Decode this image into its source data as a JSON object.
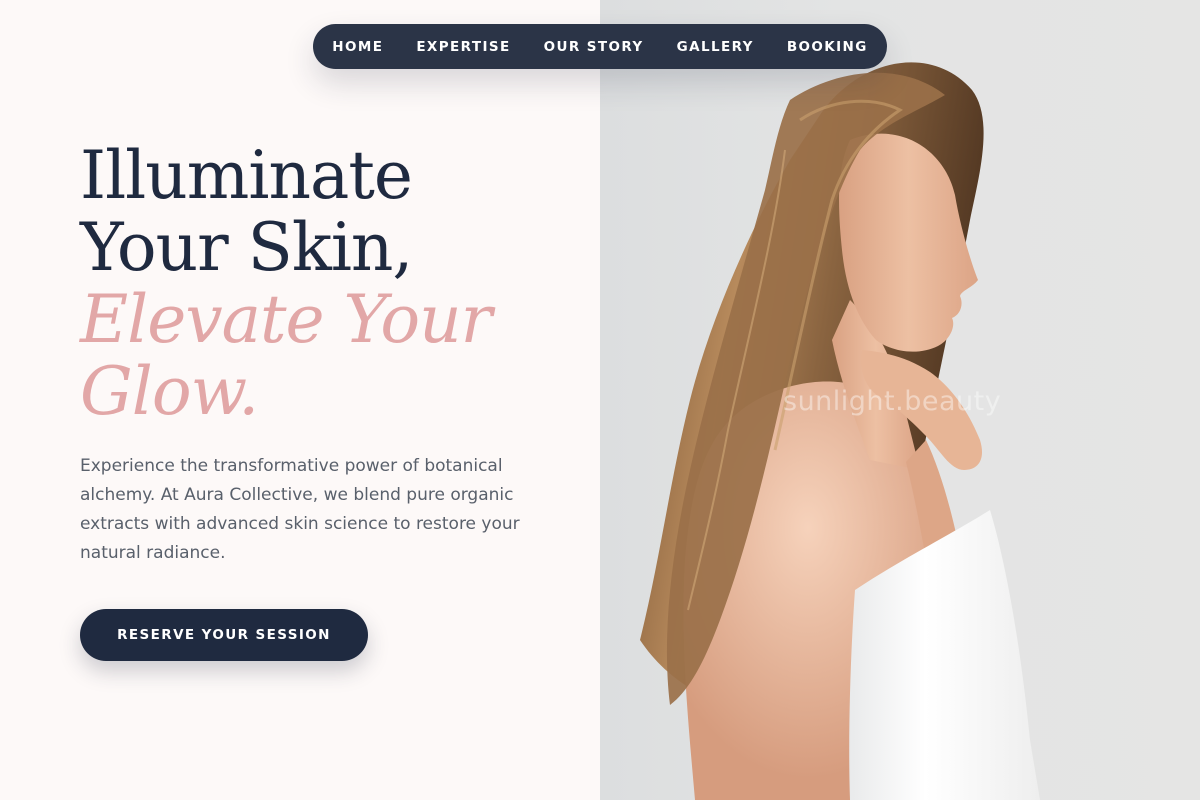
{
  "nav": {
    "items": [
      {
        "label": "HOME"
      },
      {
        "label": "EXPERTISE"
      },
      {
        "label": "OUR STORY"
      },
      {
        "label": "GALLERY"
      },
      {
        "label": "BOOKING"
      }
    ]
  },
  "hero": {
    "headline_line1": "Illuminate",
    "headline_line2": "Your Skin,",
    "headline_accent1": "Elevate Your",
    "headline_accent2": "Glow.",
    "description": "Experience the transformative power of botanical alchemy. At Aura Collective, we blend pure organic extracts with advanced skin science to restore your natural radiance.",
    "cta_label": "RESERVE YOUR SESSION"
  },
  "image": {
    "watermark": "sunlight.beauty"
  },
  "colors": {
    "navy": "#1f2a40",
    "nav_bg": "#2b3447",
    "accent_pink": "#e2a7a7",
    "body_text": "#59606b",
    "page_bg": "#fdf9f8"
  }
}
